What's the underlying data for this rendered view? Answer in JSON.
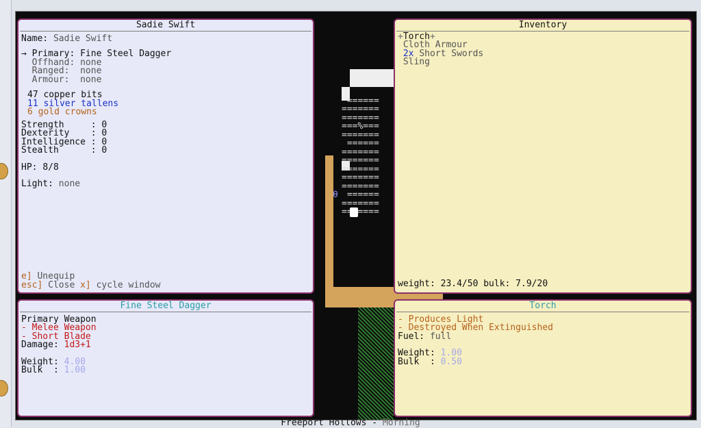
{
  "character": {
    "title": "Sadie Swift",
    "name_label": "Name:",
    "name_value": "Sadie Swift",
    "equipment": [
      {
        "marker": "→",
        "label": "Primary:",
        "value": "Fine Steel Dagger"
      },
      {
        "marker": " ",
        "label": "Offhand:",
        "value": "none"
      },
      {
        "marker": " ",
        "label": "Ranged:",
        "value": "none"
      },
      {
        "marker": " ",
        "label": "Armour:",
        "value": "none"
      }
    ],
    "money": [
      {
        "text": "47 copper bits",
        "color": "#111111"
      },
      {
        "text": "11 silver tallens",
        "color": "#1b30c8"
      },
      {
        "text": "6 gold crowns",
        "color": "#b4621c"
      }
    ],
    "stats": [
      {
        "label": "Strength",
        "value": "0"
      },
      {
        "label": "Dexterity",
        "value": "0"
      },
      {
        "label": "Intelligence",
        "value": "0"
      },
      {
        "label": "Stealth",
        "value": "0"
      }
    ],
    "hp_label": "HP:",
    "hp_value": "8/8",
    "light_label": "Light:",
    "light_value": "none",
    "hint_unequip_key": "e]",
    "hint_unequip_text": "Unequip",
    "hint_close_key": "esc]",
    "hint_close_text": "Close",
    "hint_cycle_key": "x]",
    "hint_cycle_text": "cycle window"
  },
  "inventory": {
    "title": "Inventory",
    "items": [
      {
        "prefix": "+",
        "qty": "",
        "name": "Torch",
        "suffix": "+",
        "selected": true
      },
      {
        "prefix": " ",
        "qty": "",
        "name": "Cloth Armour",
        "suffix": "",
        "selected": false
      },
      {
        "prefix": " ",
        "qty": "2x",
        "name": "Short Swords",
        "suffix": "",
        "selected": false
      },
      {
        "prefix": " ",
        "qty": "",
        "name": "Sling",
        "suffix": "",
        "selected": false
      }
    ],
    "weight_text": "weight: 23.4/50 bulk: 7.9/20"
  },
  "weapon": {
    "title": "Fine Steel Dagger",
    "type": "Primary Weapon",
    "tags": [
      "- Melee Weapon",
      "- Short Blade"
    ],
    "damage_label": "Damage:",
    "damage_value": "1d3+1",
    "weight_label": "Weight:",
    "weight_value": "4.00",
    "bulk_label": "Bulk  :",
    "bulk_value": "1.00"
  },
  "torch": {
    "title": "Torch",
    "tags": [
      "- Produces Light",
      "- Destroyed When Extinguished"
    ],
    "fuel_label": "Fuel:",
    "fuel_value": "full",
    "weight_label": "Weight:",
    "weight_value": "1.00",
    "bulk_label": "Bulk  :",
    "bulk_value": "0.50"
  },
  "status": {
    "location": "Freeport Hollows",
    "separator": "-",
    "time": "Morning"
  },
  "colors": {
    "panel_border": "#8a2f6a",
    "blue_panel": "#e7e9f8",
    "yellow_panel": "#f6efc1",
    "wood": "#d4a35c",
    "grass": "#2f7a2f"
  }
}
